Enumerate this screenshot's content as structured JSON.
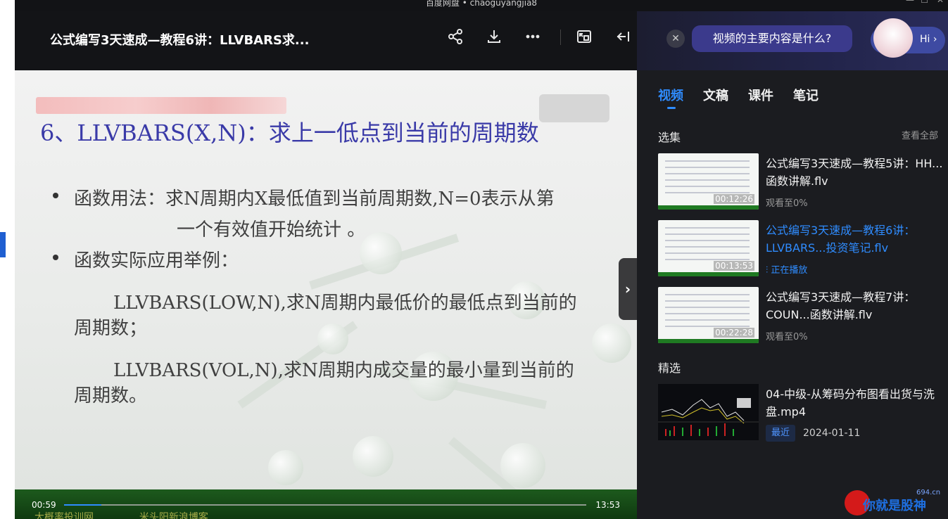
{
  "window": {
    "title": "百度网盘 • chaoguyangjia8"
  },
  "header": {
    "video_title": "公式编写3天速成—教程6讲：LLVBARS求...",
    "icons": [
      "share-icon",
      "download-icon",
      "more-icon",
      "pip-icon",
      "collapse-icon"
    ]
  },
  "slide": {
    "heading": "6、LLVBARS(X,N)：求上一低点到当前的周期数",
    "bullet1_line1": "函数用法：求N周期内X最低值到当前周期数,N=0表示从第",
    "bullet1_line2": "一个有效值开始统计 。",
    "bullet2": "函数实际应用举例：",
    "example1_line1": "LLVBARS(LOW,N),求N周期内最低价的最低点到当前的",
    "example1_line2": "周期数；",
    "example2_line1": "LLVBARS(VOL,N),求N周期内成交量的最小量到当前的",
    "example2_line2": "周期数。",
    "footer_text": "大概率投训网 ………… 米头阳新浪博客 …………"
  },
  "player": {
    "current_time": "00:59",
    "duration": "13:53",
    "progress_fraction": 0.071
  },
  "ai": {
    "question": "视频的主要内容是什么?",
    "hi_label": "Hi ›"
  },
  "tabs": [
    {
      "label": "视频",
      "active": true
    },
    {
      "label": "文稿",
      "active": false
    },
    {
      "label": "课件",
      "active": false
    },
    {
      "label": "笔记",
      "active": false
    }
  ],
  "playlist": {
    "section_title": "选集",
    "see_all": "查看全部",
    "items": [
      {
        "title": "公式编写3天速成—教程5讲：HH...函数讲解.flv",
        "duration": "00:12:26",
        "sub": "观看至0%",
        "playing": false
      },
      {
        "title": "公式编写3天速成—教程6讲：LLVBARS...投资笔记.flv",
        "duration": "00:13:53",
        "sub": "正在播放",
        "playing": true
      },
      {
        "title": "公式编写3天速成—教程7讲：COUN...函数讲解.flv",
        "duration": "00:22:28",
        "sub": "观看至0%",
        "playing": false
      }
    ]
  },
  "featured": {
    "section_title": "精选",
    "item": {
      "title": "04-中级-从筹码分布图看出货与洗盘.mp4",
      "badge": "最近",
      "date": "2024-01-11"
    }
  },
  "watermark": {
    "text": "你就是股神",
    "domain": "694.cn"
  },
  "colors": {
    "accent": "#2f8cff",
    "panel_bg": "#1b1c20",
    "header_bg": "#131417",
    "slide_heading": "#3a3aa8",
    "video_footer": "#1d5a1d"
  }
}
